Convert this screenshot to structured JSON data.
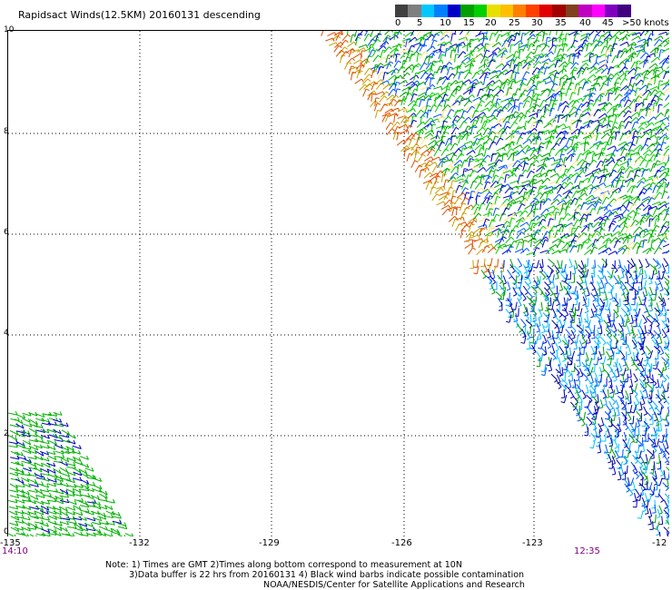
{
  "title": "Rapidsact Winds(12.5KM) 20160131 descending",
  "legend": {
    "labels": [
      "0",
      "5",
      "10",
      "15",
      "20",
      "25",
      "30",
      "35",
      "40",
      "45",
      ">50 knots"
    ],
    "colors": [
      "#404040",
      "#7f7f7f",
      "#00c8ff",
      "#0080ff",
      "#0000c8",
      "#00a000",
      "#00d000",
      "#e8e000",
      "#ffc000",
      "#ff8000",
      "#ff4000",
      "#e00000",
      "#a00000",
      "#804020",
      "#c000c0",
      "#ff00ff",
      "#8000c0",
      "#400080"
    ]
  },
  "map": {
    "x_ticks": [
      "-135",
      "-132",
      "-129",
      "-126",
      "-123",
      "-12"
    ],
    "y_ticks": [
      "10",
      "8",
      "6",
      "4",
      "2",
      "0"
    ],
    "time_left": "14:10",
    "time_right": "12:35"
  },
  "notes": {
    "line1": "Note: 1) Times are GMT 2)Times along bottom correspond to measurement at 10N",
    "line2": "3)Data buffer is 22 hrs from 20160131 4) Black wind barbs indicate possible contamination",
    "line3": "NOAA/NESDIS/Center for Satellite Applications and Research"
  }
}
